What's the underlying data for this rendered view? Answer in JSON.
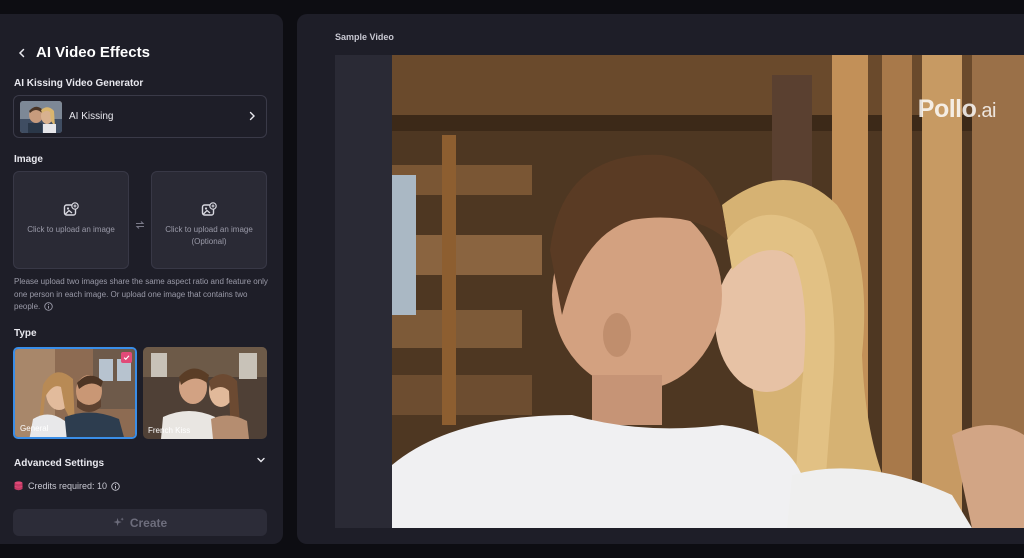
{
  "header": {
    "title": "AI Video Effects"
  },
  "generator": {
    "label": "AI Kissing Video Generator",
    "selected_effect": "AI Kissing"
  },
  "image_section": {
    "label": "Image",
    "upload_primary": "Click to upload an image",
    "upload_secondary_line1": "Click to upload an image",
    "upload_secondary_line2": "(Optional)",
    "hint": "Please upload two images share the same aspect ratio and feature only one person in each image. Or upload one image that contains two people."
  },
  "type_section": {
    "label": "Type",
    "options": [
      {
        "label": "General",
        "selected": true
      },
      {
        "label": "French Kiss",
        "selected": false
      }
    ]
  },
  "advanced": {
    "label": "Advanced Settings"
  },
  "credits": {
    "text": "Credits required: 10"
  },
  "create": {
    "label": "Create"
  },
  "sample": {
    "label": "Sample Video",
    "watermark_main": "Pollo",
    "watermark_suffix": ".ai"
  },
  "colors": {
    "panel_bg": "#1e1e28",
    "page_bg": "#0d0d12",
    "selected_border": "#3a8ee8",
    "check_badge": "#e14a78",
    "credit_coin": "#e14a78"
  },
  "icons": {
    "back": "chevron-left-icon",
    "effect_arrow": "chevron-right-icon",
    "upload": "image-plus-icon",
    "swap": "swap-icon",
    "info": "info-icon",
    "advanced": "chevron-down-icon",
    "credits": "coin-stack-icon",
    "create": "sparkle-icon"
  }
}
